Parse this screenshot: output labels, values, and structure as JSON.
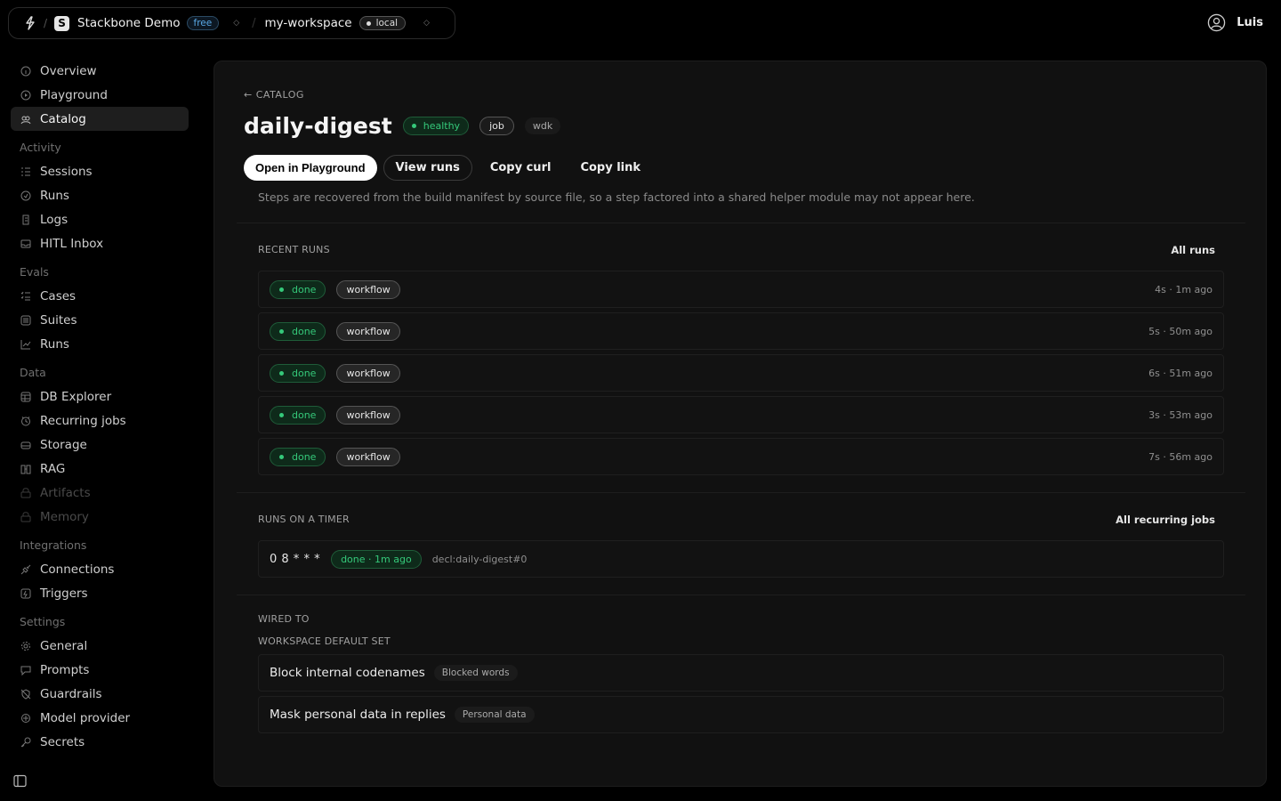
{
  "topbar": {
    "org_name": "Stackbone Demo",
    "plan": "free",
    "workspace": "my-workspace",
    "environment": "local"
  },
  "user": {
    "name": "Luis"
  },
  "sidebar": {
    "top_items": [
      {
        "label": "Overview",
        "icon": "info-icon"
      },
      {
        "label": "Playground",
        "icon": "play-icon"
      },
      {
        "label": "Catalog",
        "icon": "catalog-icon",
        "active": true
      }
    ],
    "groups": [
      {
        "label": "Activity",
        "items": [
          {
            "label": "Sessions",
            "icon": "list-icon"
          },
          {
            "label": "Runs",
            "icon": "runs-icon"
          },
          {
            "label": "Logs",
            "icon": "logs-icon"
          },
          {
            "label": "HITL Inbox",
            "icon": "inbox-icon"
          }
        ]
      },
      {
        "label": "Evals",
        "items": [
          {
            "label": "Cases",
            "icon": "checklist-icon"
          },
          {
            "label": "Suites",
            "icon": "suites-icon"
          },
          {
            "label": "Runs",
            "icon": "chart-icon"
          }
        ]
      },
      {
        "label": "Data",
        "items": [
          {
            "label": "DB Explorer",
            "icon": "database-icon"
          },
          {
            "label": "Recurring jobs",
            "icon": "clock-icon"
          },
          {
            "label": "Storage",
            "icon": "storage-icon"
          },
          {
            "label": "RAG",
            "icon": "rag-icon"
          },
          {
            "label": "Artifacts",
            "icon": "artifacts-icon",
            "disabled": true
          },
          {
            "label": "Memory",
            "icon": "memory-icon",
            "disabled": true
          }
        ]
      },
      {
        "label": "Integrations",
        "items": [
          {
            "label": "Connections",
            "icon": "plug-icon"
          },
          {
            "label": "Triggers",
            "icon": "trigger-icon"
          }
        ]
      },
      {
        "label": "Settings",
        "items": [
          {
            "label": "General",
            "icon": "gear-icon"
          },
          {
            "label": "Prompts",
            "icon": "prompt-icon"
          },
          {
            "label": "Guardrails",
            "icon": "shield-off-icon"
          },
          {
            "label": "Model provider",
            "icon": "model-icon"
          },
          {
            "label": "Secrets",
            "icon": "key-icon"
          }
        ]
      }
    ]
  },
  "main": {
    "back_label": "← CATALOG",
    "title": "daily-digest",
    "health": "healthy",
    "kind": "job",
    "sdk": "wdk",
    "actions": {
      "open_playground": "Open in Playground",
      "view_runs": "View runs",
      "copy_curl": "Copy curl",
      "copy_link": "Copy link"
    },
    "note": "Steps are recovered from the build manifest by source file, so a step factored into a shared helper module may not appear here.",
    "recent_runs": {
      "label": "RECENT RUNS",
      "link": "All runs",
      "rows": [
        {
          "status": "done",
          "kind": "workflow",
          "meta": "4s · 1m ago"
        },
        {
          "status": "done",
          "kind": "workflow",
          "meta": "5s · 50m ago"
        },
        {
          "status": "done",
          "kind": "workflow",
          "meta": "6s · 51m ago"
        },
        {
          "status": "done",
          "kind": "workflow",
          "meta": "3s · 53m ago"
        },
        {
          "status": "done",
          "kind": "workflow",
          "meta": "7s · 56m ago"
        }
      ]
    },
    "timer": {
      "label": "RUNS ON A TIMER",
      "link": "All recurring jobs",
      "cron": "0 8 * * *",
      "status": "done · 1m ago",
      "ref": "decl:daily-digest#0"
    },
    "wired": {
      "label": "WIRED TO",
      "set_label": "WORKSPACE DEFAULT SET",
      "rows": [
        {
          "name": "Block internal codenames",
          "tag": "Blocked words"
        },
        {
          "name": "Mask personal data in replies",
          "tag": "Personal data"
        }
      ]
    }
  },
  "colors": {
    "background": "#000000",
    "panel": "#111111",
    "success": "#35c97a",
    "plan_accent": "#5aa9e6"
  }
}
